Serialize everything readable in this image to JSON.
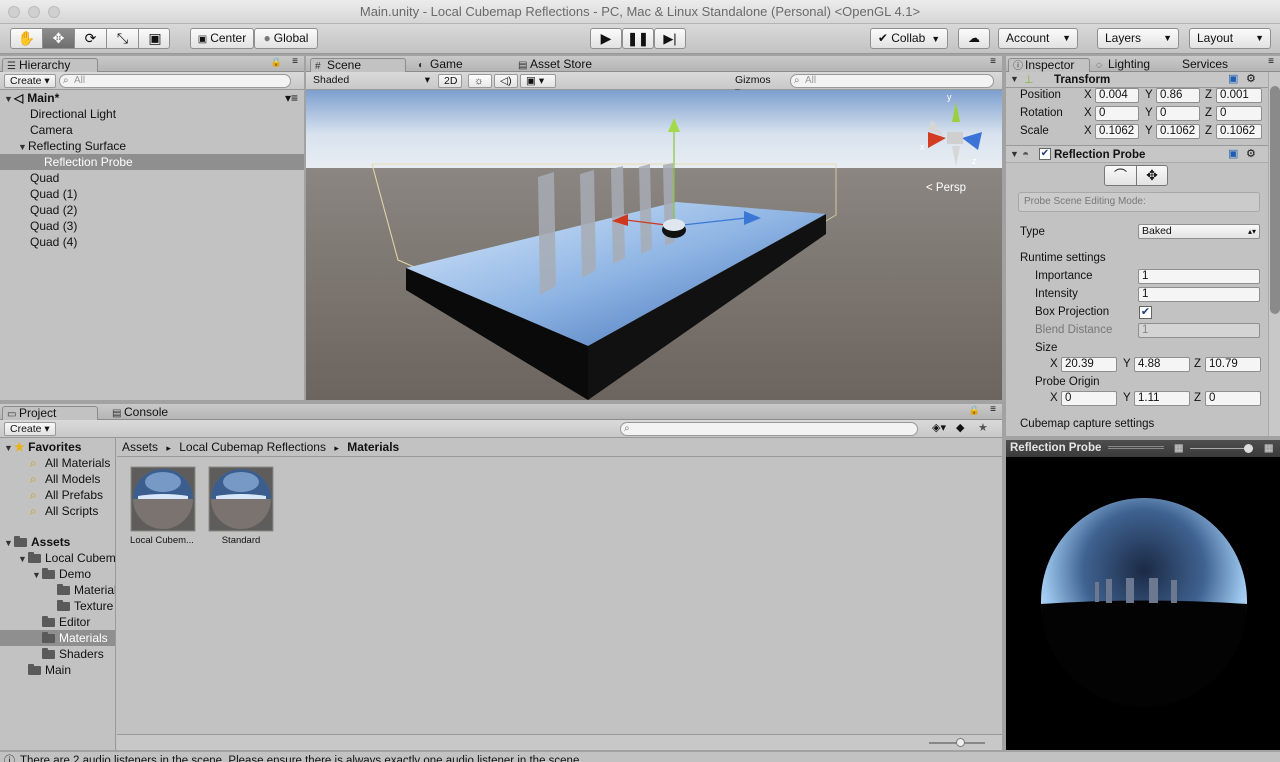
{
  "window": {
    "title": "Main.unity - Local Cubemap Reflections - PC, Mac & Linux Standalone (Personal) <OpenGL 4.1>"
  },
  "toolbar": {
    "tools": [
      "hand-icon",
      "move-icon",
      "rotate-icon",
      "scale-icon",
      "rect-icon"
    ],
    "pivot": "Center",
    "space": "Global",
    "collab": "Collab",
    "account": "Account",
    "layers": "Layers",
    "layout": "Layout"
  },
  "hierarchy": {
    "tab": "Hierarchy",
    "create": "Create",
    "search_placeholder": "All",
    "scene": "Main*",
    "items": [
      {
        "label": "Directional Light"
      },
      {
        "label": "Camera"
      },
      {
        "label": "Reflecting Surface"
      },
      {
        "label": "Reflection Probe"
      },
      {
        "label": "Quad"
      },
      {
        "label": "Quad (1)"
      },
      {
        "label": "Quad (2)"
      },
      {
        "label": "Quad (3)"
      },
      {
        "label": "Quad (4)"
      }
    ]
  },
  "scene": {
    "tabs": [
      "Scene",
      "Game",
      "Asset Store"
    ],
    "shading": "Shaded",
    "mode_2d": "2D",
    "gizmos": "Gizmos",
    "search_placeholder": "All",
    "persp": "Persp"
  },
  "inspector": {
    "tabs": [
      "Inspector",
      "Lighting",
      "Services"
    ],
    "transform": {
      "title": "Transform",
      "position_label": "Position",
      "rotation_label": "Rotation",
      "scale_label": "Scale",
      "axis_x": "X",
      "axis_y": "Y",
      "axis_z": "Z",
      "position": [
        "0.004",
        "0.86",
        "0.001"
      ],
      "rotation": [
        "0",
        "0",
        "0"
      ],
      "scale": [
        "0.1062",
        "0.1062",
        "0.1062"
      ]
    },
    "probe": {
      "title": "Reflection Probe",
      "editing_mode": "Probe Scene Editing Mode:",
      "type_label": "Type",
      "type_value": "Baked",
      "runtime_label": "Runtime settings",
      "importance_label": "Importance",
      "importance": "1",
      "intensity_label": "Intensity",
      "intensity": "1",
      "box_projection_label": "Box Projection",
      "blend_label": "Blend Distance",
      "blend": "1",
      "size_label": "Size",
      "size": [
        "20.39",
        "4.88",
        "10.79"
      ],
      "origin_label": "Probe Origin",
      "origin": [
        "0",
        "1.11",
        "0"
      ],
      "cubemap_label": "Cubemap capture settings"
    }
  },
  "preview": {
    "title": "Reflection Probe"
  },
  "project": {
    "tabs": [
      "Project",
      "Console"
    ],
    "create": "Create",
    "favorites_label": "Favorites",
    "favorites": [
      "All Materials",
      "All Models",
      "All Prefabs",
      "All Scripts"
    ],
    "assets_label": "Assets",
    "tree": [
      {
        "label": "Local Cubem"
      },
      {
        "label": "Demo"
      },
      {
        "label": "Material"
      },
      {
        "label": "Texture"
      },
      {
        "label": "Editor"
      },
      {
        "label": "Materials"
      },
      {
        "label": "Shaders"
      },
      {
        "label": "Main"
      }
    ],
    "breadcrumb": [
      "Assets",
      "Local Cubemap Reflections",
      "Materials"
    ],
    "materials": [
      "Local Cubem...",
      "Standard"
    ]
  },
  "status": {
    "message": "There are 2 audio listeners in the scene. Please ensure there is always exactly one audio listener in the scene."
  },
  "colors": {
    "sel": "#8f8f8f",
    "sky": "#8fb0d8",
    "ground": "#726a64"
  }
}
